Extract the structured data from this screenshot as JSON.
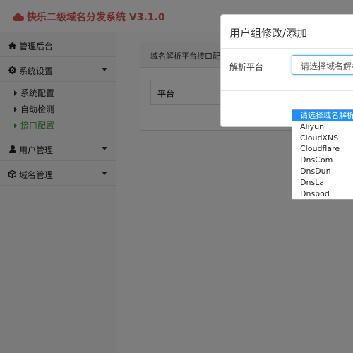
{
  "app": {
    "title": "快乐二级域名分发系统 V3.1.0",
    "brand_color": "#d9534f"
  },
  "sidebar": {
    "items": [
      {
        "label": "管理后台",
        "icon": "home-icon"
      },
      {
        "label": "系统设置",
        "icon": "gear-icon"
      },
      {
        "label": "用户管理",
        "icon": "user-icon"
      },
      {
        "label": "域名管理",
        "icon": "cube-icon"
      }
    ],
    "sub_items": [
      {
        "label": "系统配置",
        "active": false
      },
      {
        "label": "自动检测",
        "active": false
      },
      {
        "label": "接口配置",
        "active": true
      }
    ],
    "active_color": "#3c9a3c"
  },
  "main": {
    "panel_title": "域名解析平台接口配置",
    "table_header": "平台"
  },
  "modal": {
    "title": "用户组修改/添加",
    "field_label": "解析平台",
    "select_value": "请选择域名解析平台",
    "options": [
      "请选择域名解析平台",
      "Aliyun",
      "CloudXNS",
      "Cloudflare",
      "DnsCom",
      "DnsDun",
      "DnsLa",
      "Dnspod"
    ],
    "selected_index": 0,
    "selected_color": "#1e90ff"
  }
}
